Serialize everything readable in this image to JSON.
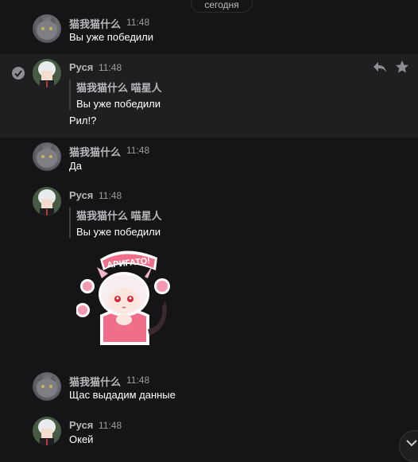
{
  "date_divider": "сегодня",
  "messages": [
    {
      "author": "猫我猫什么",
      "time": "11:48",
      "text": "Вы уже победили"
    },
    {
      "author": "Руся",
      "time": "11:48",
      "quote_author": "猫我猫什么 喵星人",
      "quote_text": "Вы уже победили",
      "text": "Рил!?"
    },
    {
      "author": "猫我猫什么",
      "time": "11:48",
      "text": "Да"
    },
    {
      "author": "Руся",
      "time": "11:48",
      "quote_author": "猫我猫什么 喵星人",
      "quote_text": "Вы уже победили",
      "sticker_text": "АРИГАТО!"
    },
    {
      "author": "猫我猫什么",
      "time": "11:48",
      "text": "Щас выдадим данные"
    },
    {
      "author": "Руся",
      "time": "11:48",
      "text": "Окей"
    }
  ],
  "icons": {
    "check": "check-circle-icon",
    "reply": "reply-icon",
    "star": "star-icon",
    "scroll": "chevron-down-icon"
  },
  "colors": {
    "background": "#151517",
    "hover_row": "#1f1f22",
    "name": "#b8b8bc",
    "timestamp": "#9c9ca0",
    "sticker_pink": "#ef6f8a"
  }
}
